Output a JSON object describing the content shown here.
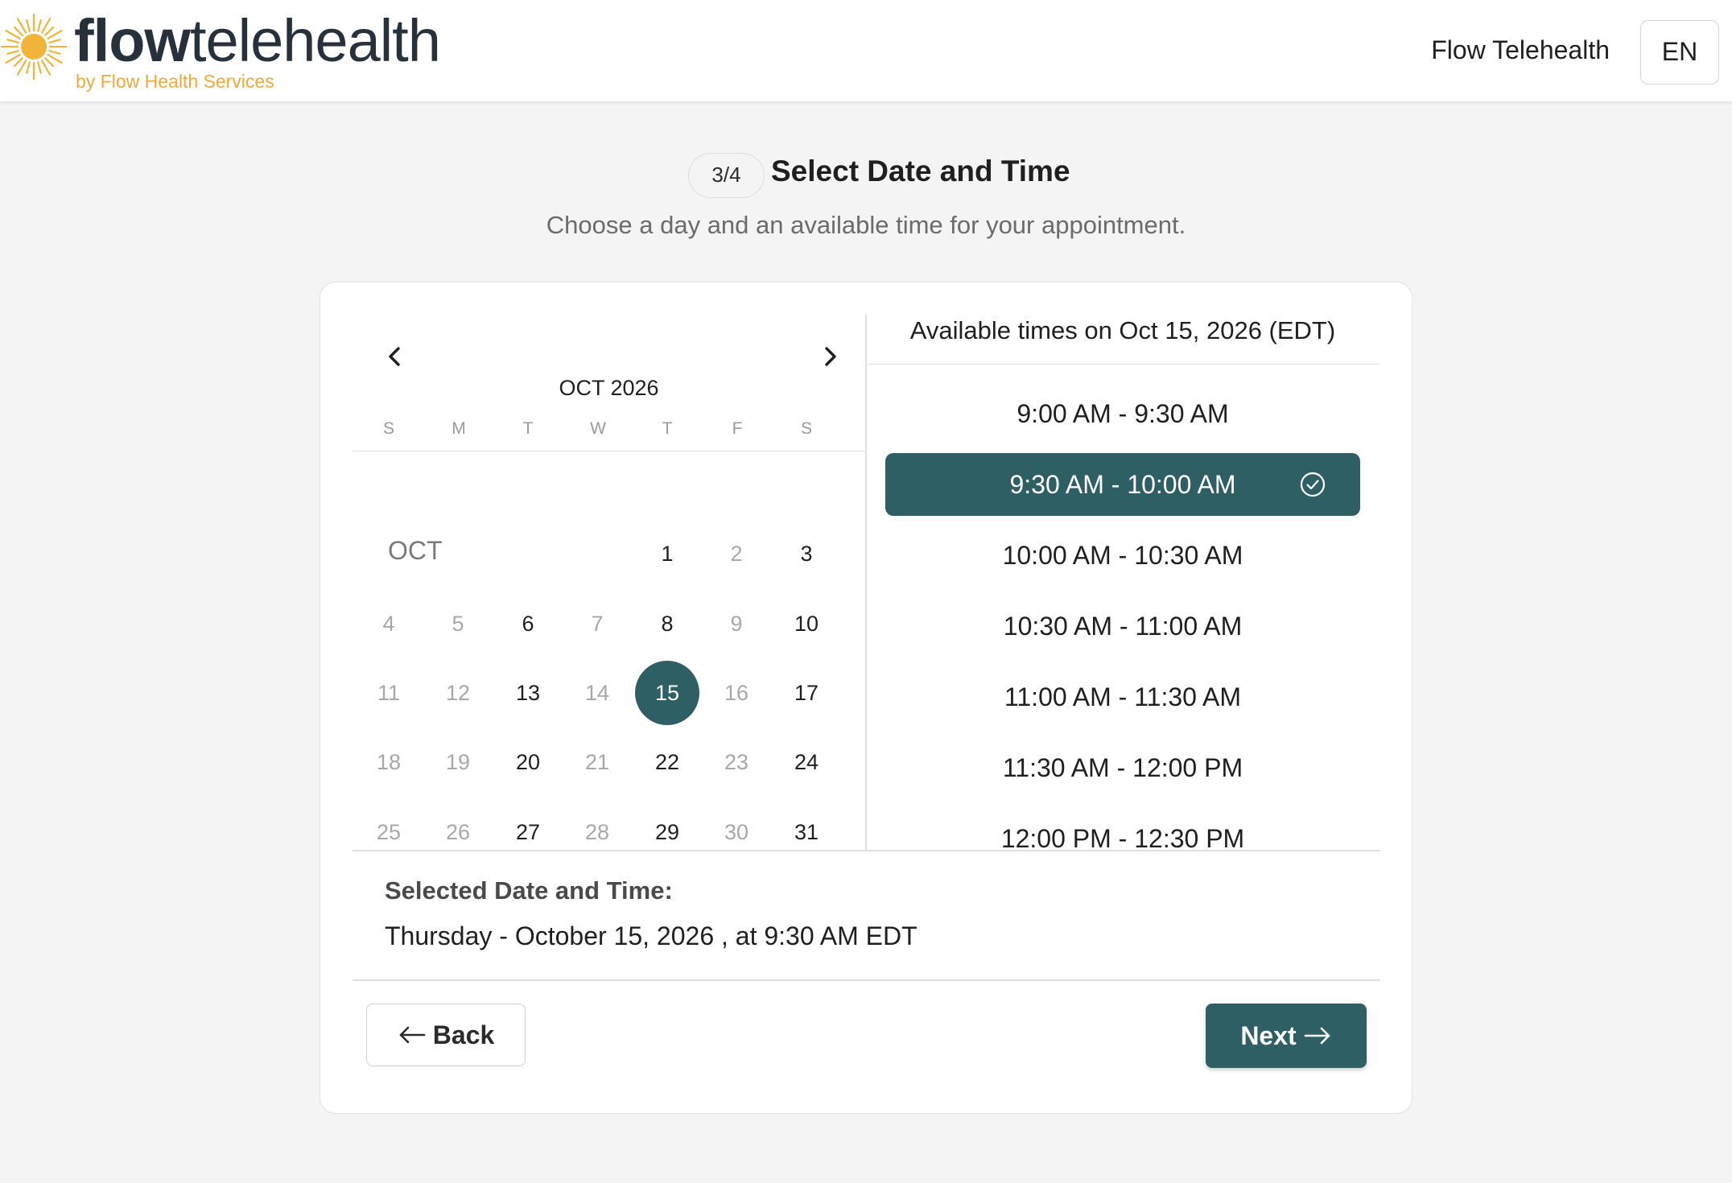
{
  "header": {
    "logo": {
      "word_bold": "flow",
      "word_light": "telehealth",
      "tagline": "by Flow Health Services"
    },
    "brand_link": "Flow Telehealth",
    "language": "EN"
  },
  "step": {
    "indicator": "3/4",
    "title": "Select Date and Time",
    "subtitle": "Choose a day and an available time for your appointment."
  },
  "calendar": {
    "month_label": "OCT 2026",
    "month_short": "OCT",
    "weekdays": [
      "S",
      "M",
      "T",
      "W",
      "T",
      "F",
      "S"
    ],
    "days": [
      {
        "d": "1",
        "state": "available"
      },
      {
        "d": "2",
        "state": "unavailable"
      },
      {
        "d": "3",
        "state": "available"
      },
      {
        "d": "4",
        "state": "unavailable"
      },
      {
        "d": "5",
        "state": "unavailable"
      },
      {
        "d": "6",
        "state": "available"
      },
      {
        "d": "7",
        "state": "unavailable"
      },
      {
        "d": "8",
        "state": "available"
      },
      {
        "d": "9",
        "state": "unavailable"
      },
      {
        "d": "10",
        "state": "available"
      },
      {
        "d": "11",
        "state": "unavailable"
      },
      {
        "d": "12",
        "state": "unavailable"
      },
      {
        "d": "13",
        "state": "available"
      },
      {
        "d": "14",
        "state": "unavailable"
      },
      {
        "d": "15",
        "state": "selected"
      },
      {
        "d": "16",
        "state": "unavailable"
      },
      {
        "d": "17",
        "state": "available"
      },
      {
        "d": "18",
        "state": "unavailable"
      },
      {
        "d": "19",
        "state": "unavailable"
      },
      {
        "d": "20",
        "state": "available"
      },
      {
        "d": "21",
        "state": "unavailable"
      },
      {
        "d": "22",
        "state": "available"
      },
      {
        "d": "23",
        "state": "unavailable"
      },
      {
        "d": "24",
        "state": "available"
      },
      {
        "d": "25",
        "state": "unavailable"
      },
      {
        "d": "26",
        "state": "unavailable"
      },
      {
        "d": "27",
        "state": "available"
      },
      {
        "d": "28",
        "state": "unavailable"
      },
      {
        "d": "29",
        "state": "available"
      },
      {
        "d": "30",
        "state": "unavailable"
      },
      {
        "d": "31",
        "state": "available"
      }
    ]
  },
  "times": {
    "header": "Available times on Oct 15, 2026 (EDT)",
    "slots": [
      {
        "label": "9:00 AM - 9:30 AM",
        "selected": false
      },
      {
        "label": "9:30 AM - 10:00 AM",
        "selected": true
      },
      {
        "label": "10:00 AM - 10:30 AM",
        "selected": false
      },
      {
        "label": "10:30 AM - 11:00 AM",
        "selected": false
      },
      {
        "label": "11:00 AM - 11:30 AM",
        "selected": false
      },
      {
        "label": "11:30 AM - 12:00 PM",
        "selected": false
      },
      {
        "label": "12:00 PM - 12:30 PM",
        "selected": false
      }
    ]
  },
  "selection": {
    "label": "Selected Date and Time:",
    "value": "Thursday - October 15, 2026 , at 9:30 AM EDT"
  },
  "actions": {
    "back": "Back",
    "next": "Next"
  },
  "colors": {
    "accent": "#2e5f64",
    "logo_sun": "#f2b43a",
    "logo_text": "#27313c"
  },
  "icons": {
    "prev": "chevron-left-icon",
    "next": "chevron-right-icon",
    "check": "check-circle-icon",
    "back": "arrow-left-icon",
    "forward": "arrow-right-icon"
  }
}
